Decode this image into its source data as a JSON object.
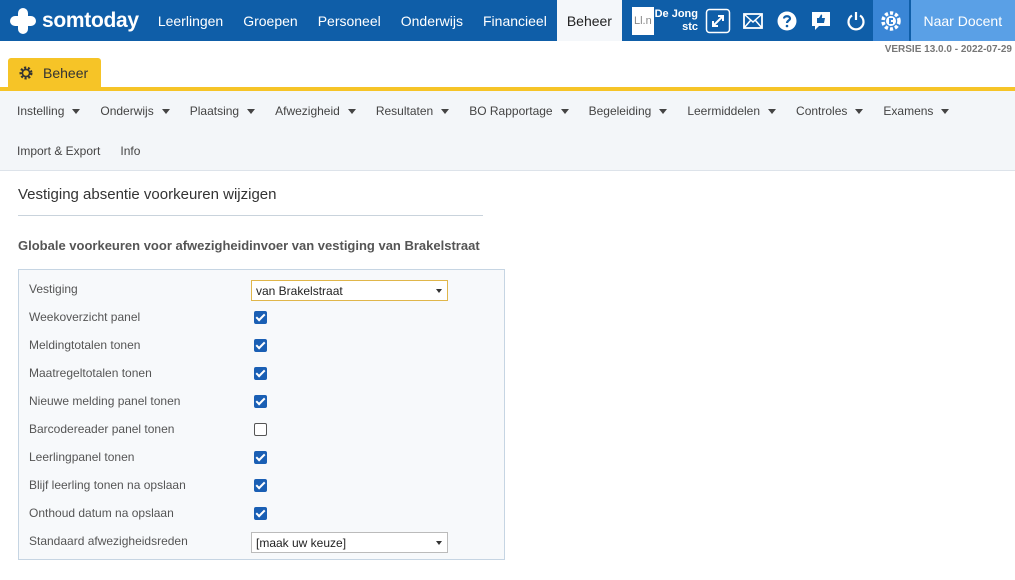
{
  "brand": {
    "name": "somtoday"
  },
  "nav": {
    "items": [
      "Leerlingen",
      "Groepen",
      "Personeel",
      "Onderwijs",
      "Financieel",
      "Beheer"
    ],
    "active": "Beheer"
  },
  "user": {
    "initials": "Ll.n",
    "name_line1": "De Jong",
    "name_line2": "stc"
  },
  "icons": [
    "expand-icon",
    "mail-icon",
    "help-icon",
    "feedback-icon",
    "power-icon",
    "settings-gear-icon"
  ],
  "naar_docent": "Naar Docent",
  "version": "VERSIE 13.0.0 - 2022-07-29",
  "module_tab": {
    "label": "Beheer"
  },
  "submenu": {
    "row1": [
      {
        "label": "Instelling",
        "has_caret": true
      },
      {
        "label": "Onderwijs",
        "has_caret": true
      },
      {
        "label": "Plaatsing",
        "has_caret": true
      },
      {
        "label": "Afwezigheid",
        "has_caret": true
      },
      {
        "label": "Resultaten",
        "has_caret": true
      },
      {
        "label": "BO Rapportage",
        "has_caret": true
      },
      {
        "label": "Begeleiding",
        "has_caret": true
      },
      {
        "label": "Leermiddelen",
        "has_caret": true
      },
      {
        "label": "Controles",
        "has_caret": true
      },
      {
        "label": "Examens",
        "has_caret": true
      }
    ],
    "row2": [
      {
        "label": "Import & Export",
        "has_caret": false
      },
      {
        "label": "Info",
        "has_caret": false
      }
    ]
  },
  "page": {
    "title": "Vestiging absentie voorkeuren wijzigen",
    "subtitle": "Globale voorkeuren voor afwezigheidinvoer van vestiging van Brakelstraat"
  },
  "form": {
    "vestiging_label": "Vestiging",
    "vestiging_value": "van Brakelstraat",
    "checkboxes": [
      {
        "label": "Weekoverzicht panel",
        "checked": true
      },
      {
        "label": "Meldingtotalen tonen",
        "checked": true
      },
      {
        "label": "Maatregeltotalen tonen",
        "checked": true
      },
      {
        "label": "Nieuwe melding panel tonen",
        "checked": true
      },
      {
        "label": "Barcodereader panel tonen",
        "checked": false
      },
      {
        "label": "Leerlingpanel tonen",
        "checked": true
      },
      {
        "label": "Blijf leerling tonen na opslaan",
        "checked": true
      },
      {
        "label": "Onthoud datum na opslaan",
        "checked": true
      }
    ],
    "reden_label": "Standaard afwezigheidsreden",
    "reden_value": "[maak uw keuze]"
  },
  "colors": {
    "nav_bg": "#0f5ea8",
    "module_yellow": "#f6c427",
    "checkbox_blue": "#1a5fb4",
    "naar_docent_bg": "#5aa0e6"
  }
}
